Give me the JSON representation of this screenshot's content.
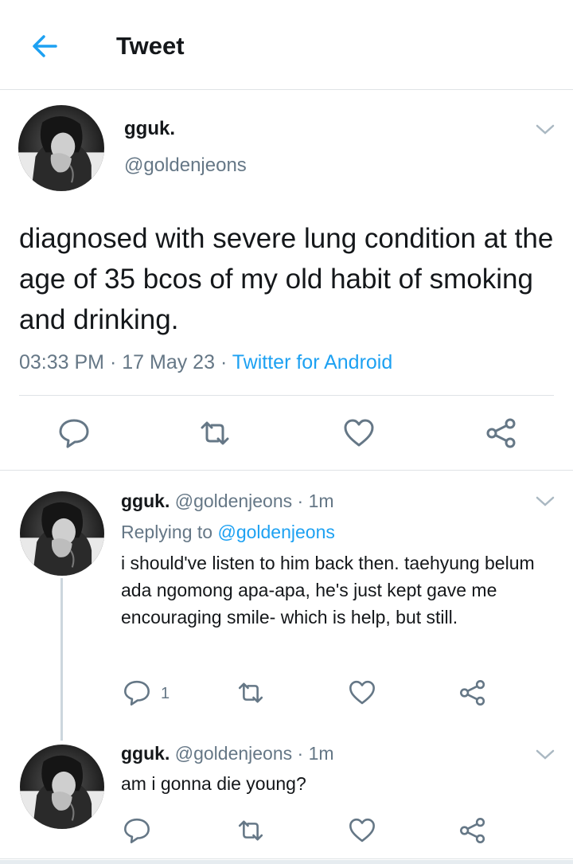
{
  "header": {
    "title": "Tweet"
  },
  "main_tweet": {
    "name": "gguk.",
    "handle": "@goldenjeons",
    "text": "diagnosed with severe lung condition at the age of 35 bcos of my old habit of smoking and drinking.",
    "time": "03:33 PM",
    "date": "17 May 23",
    "separator": "·",
    "source": "Twitter for Android"
  },
  "replies": [
    {
      "name": "gguk.",
      "handle": "@goldenjeons",
      "time": "· 1m",
      "replying_prefix": "Replying to",
      "replying_to": "@goldenjeons",
      "text": "i should've listen to him back then. taehyung belum ada ngomong apa-apa, he's just kept gave me encouraging smile- which is help, but still.",
      "reply_count": "1"
    },
    {
      "name": "gguk.",
      "handle": "@goldenjeons",
      "time": "· 1m",
      "text": "am i gonna die young?"
    }
  ],
  "icons": {
    "back": "arrow-left-icon",
    "menu": "chevron-down-icon",
    "reply": "reply-icon",
    "retweet": "retweet-icon",
    "like": "heart-icon",
    "share": "share-icon"
  },
  "colors": {
    "accent": "#1da1f2",
    "secondary_text": "#657786",
    "divider": "#dfe3e6"
  }
}
